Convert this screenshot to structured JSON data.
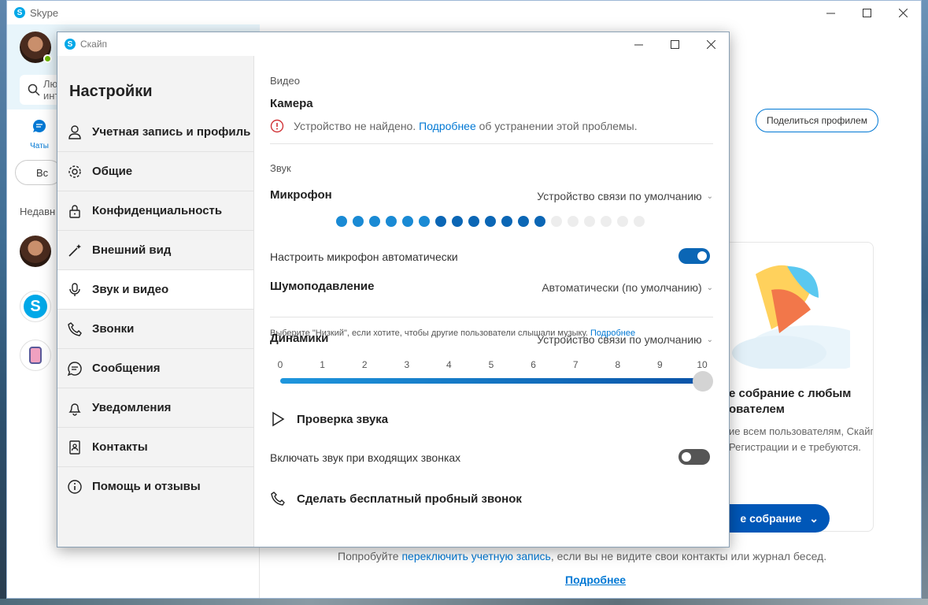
{
  "main_window": {
    "title": "Skype",
    "search_placeholder": "Лю инт",
    "chats_tab": "Чаты",
    "meet_pill": "Вс",
    "recent_label": "Недавн",
    "share_profile": "Поделиться профилем",
    "promo": {
      "title": "е собрание с любым ователем",
      "text": "ие всем пользователям, Скайпа. Регистрации и е требуются.",
      "button": "е собрание"
    },
    "bottom": {
      "prefix": "Попробуйте ",
      "link": "переключить учетную запись",
      "suffix": ", если вы не видите свои контакты или журнал бесед.",
      "more": "Подробнее"
    }
  },
  "dialog": {
    "title": "Скайп",
    "heading": "Настройки",
    "menu": [
      {
        "label": "Учетная запись и профиль",
        "icon": "person-icon",
        "active": false
      },
      {
        "label": "Общие",
        "icon": "gear-icon",
        "active": false
      },
      {
        "label": "Конфиденциальность",
        "icon": "lock-icon",
        "active": false
      },
      {
        "label": "Внешний вид",
        "icon": "magic-wand-icon",
        "active": false
      },
      {
        "label": "Звук и видео",
        "icon": "microphone-icon",
        "active": true
      },
      {
        "label": "Звонки",
        "icon": "phone-icon",
        "active": false
      },
      {
        "label": "Сообщения",
        "icon": "chat-bubble-icon",
        "active": false
      },
      {
        "label": "Уведомления",
        "icon": "bell-icon",
        "active": false
      },
      {
        "label": "Контакты",
        "icon": "contact-book-icon",
        "active": false
      },
      {
        "label": "Помощь и отзывы",
        "icon": "info-icon",
        "active": false
      }
    ],
    "video": {
      "section": "Видео",
      "camera_title": "Камера",
      "error_prefix": "Устройство не найдено. ",
      "error_link": "Подробнее",
      "error_suffix": " об устранении этой проблемы."
    },
    "audio": {
      "section": "Звук",
      "mic_title": "Микрофон",
      "mic_device": "Устройство связи по умолчанию",
      "mic_level_active": 13,
      "mic_level_total": 19,
      "auto_mic_label": "Настроить микрофон автоматически",
      "auto_mic_on": true,
      "noise_title": "Шумоподавление",
      "noise_value": "Автоматически (по умолчанию)",
      "noise_hint": "Выберите \"Низкий\", если хотите, чтобы другие пользователи слышали музыку.",
      "noise_hint_link": "Подробнее",
      "speakers_title": "Динамики",
      "speakers_device": "Устройство связи по умолчанию",
      "volume_scale": [
        "0",
        "1",
        "2",
        "3",
        "4",
        "5",
        "6",
        "7",
        "8",
        "9",
        "10"
      ],
      "volume_value": 10,
      "sound_test": "Проверка звука",
      "incoming_ring_label": "Включать звук при входящих звонках",
      "incoming_ring_on": false,
      "test_call": "Сделать бесплатный пробный звонок"
    }
  }
}
